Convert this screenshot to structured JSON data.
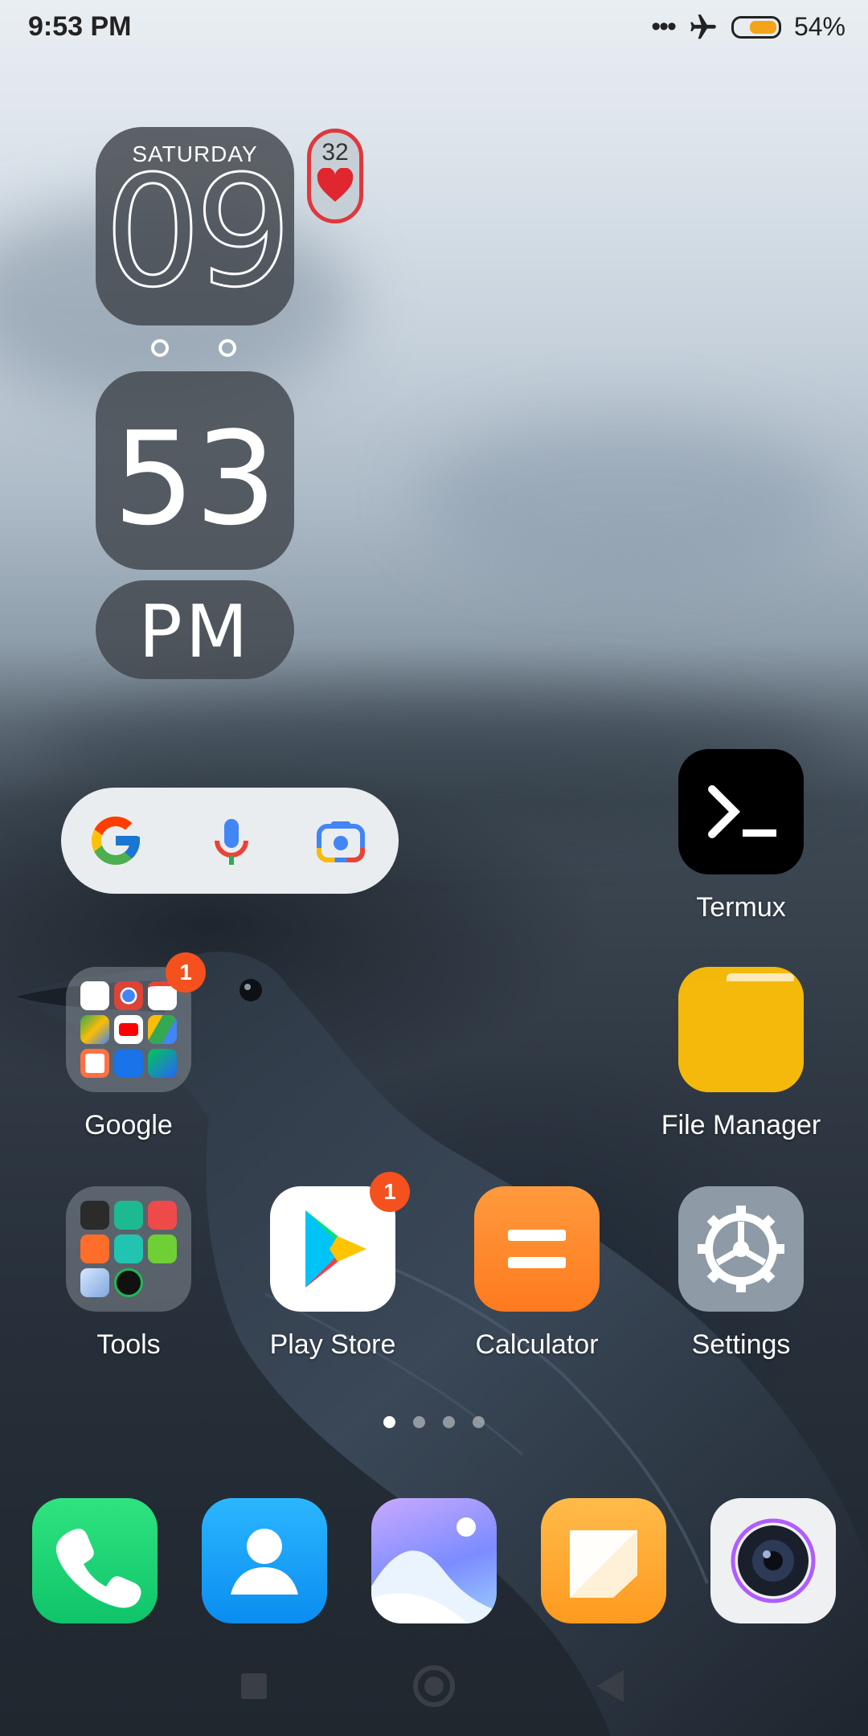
{
  "status_bar": {
    "time": "9:53 PM",
    "battery_percent": "54%",
    "battery_level": 0.54,
    "icons": [
      "more-dots-icon",
      "airplane-mode-icon",
      "battery-icon"
    ]
  },
  "clock_widget": {
    "day": "SATURDAY",
    "hour": "09",
    "minute": "53",
    "ampm": "PM"
  },
  "heart_widget": {
    "count": "32",
    "icon": "heart-icon"
  },
  "search_bar": {
    "icons": [
      "google-g-icon",
      "microphone-icon",
      "google-lens-icon"
    ]
  },
  "apps": {
    "termux": "Termux",
    "file_manager": "File Manager",
    "google_folder": "Google",
    "google_folder_badge": "1",
    "tools_folder": "Tools",
    "play_store": "Play Store",
    "play_store_badge": "1",
    "calculator": "Calculator",
    "settings": "Settings"
  },
  "page_indicator": {
    "pages": 4,
    "active": 1
  },
  "dock": [
    "phone-icon",
    "contacts-icon",
    "gallery-icon",
    "notes-icon",
    "camera-icon"
  ],
  "nav_bar": [
    "recents-button",
    "home-button",
    "back-button"
  ]
}
